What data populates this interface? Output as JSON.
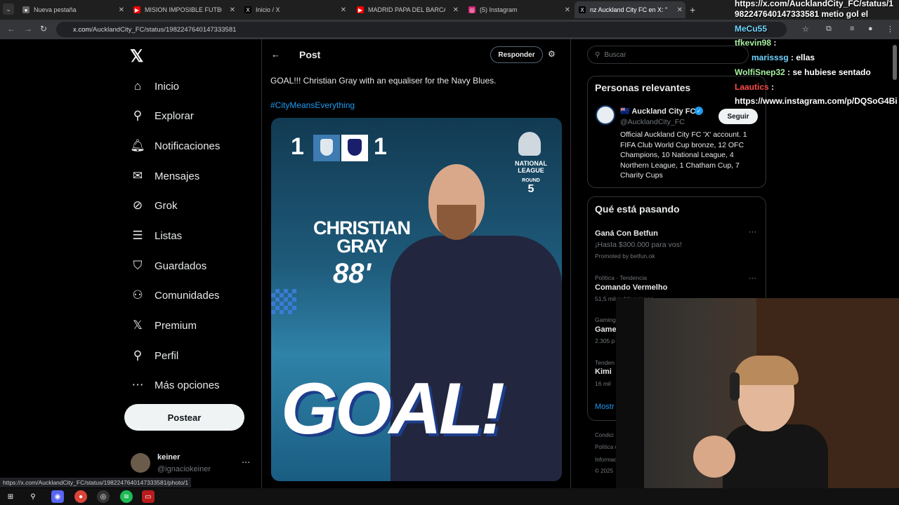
{
  "browser": {
    "tabs": [
      {
        "label": "Nueva pestaña",
        "icon": "chrome-icon",
        "active": false
      },
      {
        "label": "MISION IMPOSIBLE FUTBOLER/",
        "icon": "youtube-icon",
        "active": false
      },
      {
        "label": "Inicio / X",
        "icon": "x-icon",
        "active": false
      },
      {
        "label": "MADRID PAPA DEL BARCA?? -",
        "icon": "youtube-icon",
        "active": false
      },
      {
        "label": "(5) Instagram",
        "icon": "instagram-icon",
        "active": false
      },
      {
        "label": "nz Auckland City FC en X: \"88'",
        "icon": "x-icon",
        "active": true
      }
    ],
    "url_host": "x.com",
    "url_path": "/AucklandCity_FC/status/1982247640147333581",
    "status_url": "https://x.com/AucklandCity_FC/status/1982247640147333581/photo/1"
  },
  "x_nav": {
    "items": [
      {
        "label": "Inicio",
        "icon": "home-icon"
      },
      {
        "label": "Explorar",
        "icon": "search-icon"
      },
      {
        "label": "Notificaciones",
        "icon": "bell-icon"
      },
      {
        "label": "Mensajes",
        "icon": "mail-icon"
      },
      {
        "label": "Grok",
        "icon": "grok-icon"
      },
      {
        "label": "Listas",
        "icon": "list-icon"
      },
      {
        "label": "Guardados",
        "icon": "bookmark-icon"
      },
      {
        "label": "Comunidades",
        "icon": "communities-icon"
      },
      {
        "label": "Premium",
        "icon": "x-icon"
      },
      {
        "label": "Perfil",
        "icon": "person-icon"
      },
      {
        "label": "Más opciones",
        "icon": "more-icon"
      }
    ],
    "post_button": "Postear",
    "account": {
      "name": "keiner",
      "handle": "@ignaciokeiner"
    }
  },
  "post": {
    "header_title": "Post",
    "reply_button": "Responder",
    "text": "GOAL!!! Christian Gray with an equaliser for the Navy Blues.",
    "hashtag": "#CityMeansEverything",
    "image": {
      "score_home": "1",
      "score_away": "1",
      "league": "NATIONAL LEAGUE",
      "round_label": "ROUND",
      "round_number": "5",
      "player_name": "CHRISTIAN GRAY",
      "minute": "88'",
      "goal": "GOAL!"
    }
  },
  "sidebar": {
    "search_placeholder": "Buscar",
    "relevant": {
      "title": "Personas relevantes",
      "name": "Auckland City FC",
      "handle": "@AucklandCity_FC",
      "follow": "Seguir",
      "bio": "Official Auckland City FC 'X' account. 1 FIFA Club World Cup bronze, 12 OFC Champions, 10 National League, 4 Northern League, 1 Chatham Cup, 7 Charity Cups"
    },
    "trending": {
      "title": "Qué está pasando",
      "items": [
        {
          "meta": "",
          "name": "Ganá Con Betfun",
          "extra": "¡Hasta $300.000 para vos!",
          "promo": "Promoted by betfun.ok"
        },
        {
          "meta": "Política · Tendencia",
          "name": "Comando Vermelho",
          "extra": "51,5 mil publicaciones",
          "promo": ""
        },
        {
          "meta": "Gaming",
          "name": "Game",
          "extra": "2.305 p",
          "promo": ""
        },
        {
          "meta": "Tenden",
          "name": "Kimi",
          "extra": "16 mil",
          "promo": ""
        }
      ],
      "show_more": "Mostr"
    },
    "footer": [
      "Condici",
      "Política c",
      "Informac",
      "© 2025"
    ]
  },
  "chat": [
    {
      "user": "",
      "text": "https://x.com/AucklandCity_FC/status/1",
      "color": "white"
    },
    {
      "user": "",
      "text": "982247640147333581 metio gol el",
      "color": "white"
    },
    {
      "user": "MeCu55",
      "text": "",
      "color": "cyan"
    },
    {
      "user": "tfkevin98",
      "text": ":",
      "color": "green"
    },
    {
      "user": "marisssg",
      "text": ": ellas",
      "color": "cyan"
    },
    {
      "user": "WolfiSnep32",
      "text": ": se hubiese sentado",
      "color": "green"
    },
    {
      "user": "Laautics",
      "text": ":",
      "color": "red"
    },
    {
      "user": "",
      "text": "https://www.instagram.com/p/DQSoG4Bi",
      "color": "white"
    }
  ],
  "taskbar": {
    "icons": [
      "windows-icon",
      "search-icon",
      "discord-icon",
      "chrome-icon",
      "obs-icon",
      "spotify-icon",
      "stream-app-icon"
    ]
  }
}
